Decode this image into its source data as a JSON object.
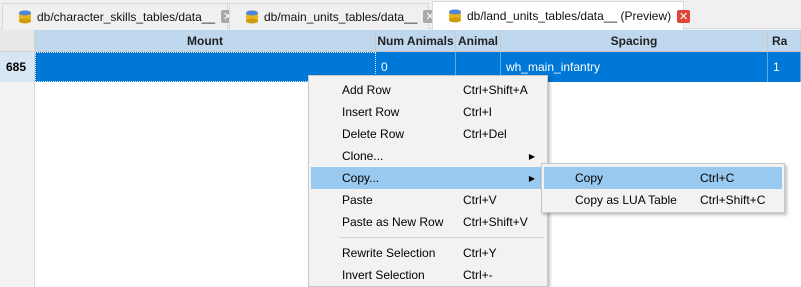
{
  "tabs": [
    {
      "label": "db/character_skills_tables/data__",
      "active": false
    },
    {
      "label": "db/main_units_tables/data__",
      "active": false
    },
    {
      "label": "db/land_units_tables/data__ (Preview)",
      "active": true
    }
  ],
  "table": {
    "columns": [
      "Mount",
      "Num Animals",
      "Animal",
      "Spacing",
      "Ra"
    ],
    "row": {
      "index": "685",
      "cells": [
        "",
        "0",
        "",
        "wh_main_infantry",
        "1"
      ]
    }
  },
  "context_menu": {
    "items": [
      {
        "label": "Add Row",
        "shortcut": "Ctrl+Shift+A"
      },
      {
        "label": "Insert Row",
        "shortcut": "Ctrl+I"
      },
      {
        "label": "Delete Row",
        "shortcut": "Ctrl+Del"
      },
      {
        "label": "Clone...",
        "shortcut": ""
      },
      {
        "label": "Copy...",
        "shortcut": ""
      },
      {
        "label": "Paste",
        "shortcut": "Ctrl+V"
      },
      {
        "label": "Paste as New Row",
        "shortcut": "Ctrl+Shift+V"
      },
      {
        "label": "Rewrite Selection",
        "shortcut": "Ctrl+Y"
      },
      {
        "label": "Invert Selection",
        "shortcut": "Ctrl+-"
      }
    ]
  },
  "submenu": {
    "items": [
      {
        "label": "Copy",
        "shortcut": "Ctrl+C"
      },
      {
        "label": "Copy as LUA Table",
        "shortcut": "Ctrl+Shift+C"
      }
    ]
  },
  "colors": {
    "selection": "#0078d7",
    "menu_highlight": "#99c9ef",
    "header_bg": "#bfd8ee",
    "close_active": "#e0453a"
  },
  "icons": {
    "tab": "database-icon",
    "close": "close-icon",
    "submenu": "chevron-right-icon"
  }
}
